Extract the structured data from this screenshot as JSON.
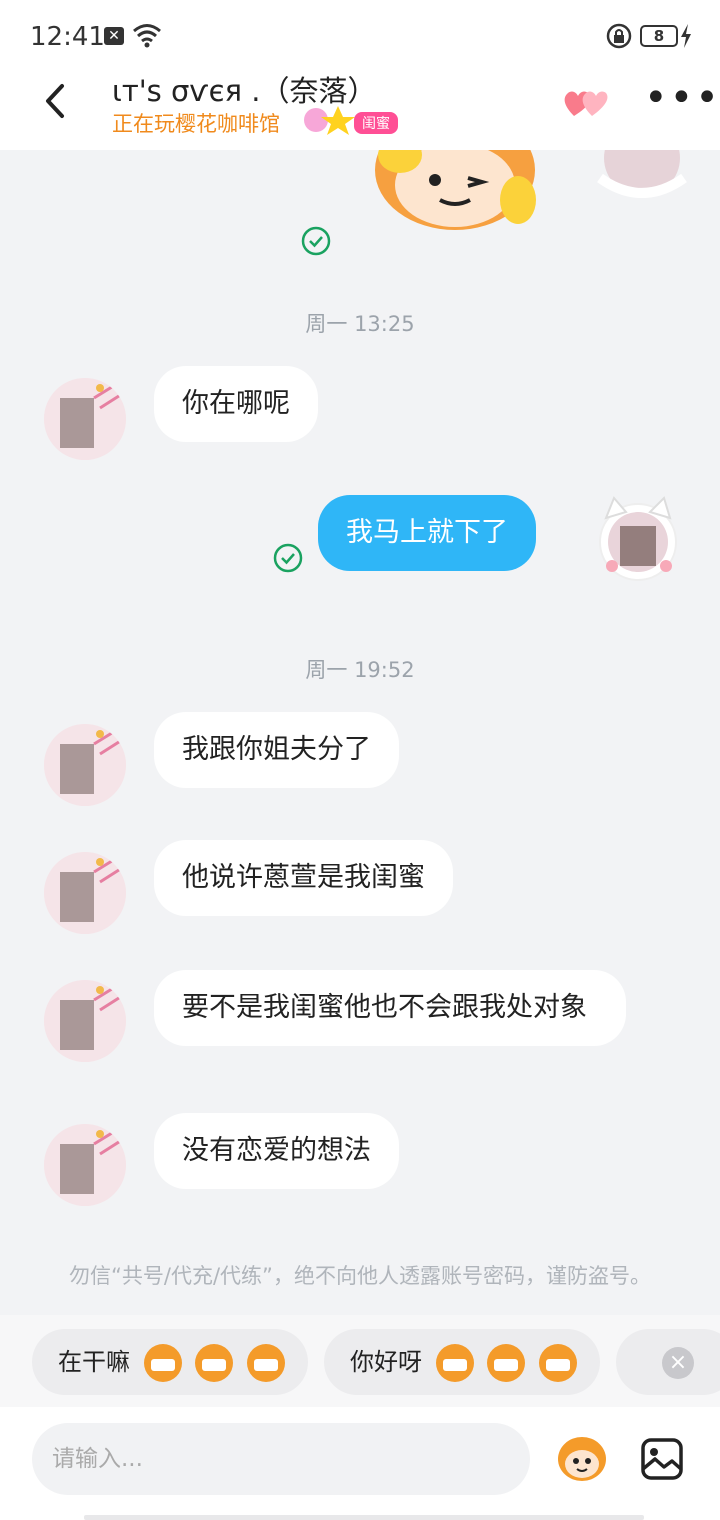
{
  "status_bar": {
    "time": "12:41",
    "notif_badge": "✕",
    "battery": "8"
  },
  "header": {
    "back_icon": "chevron-left-icon",
    "contact_name": "ιт'ѕ σѵєя .（奈落）",
    "playing_status": "正在玩樱花咖啡馆",
    "relationship_tag": "闺蜜",
    "accent_color": "#f08a1c"
  },
  "chat": {
    "messages": [
      {
        "type": "time",
        "text": "周一 13:25"
      },
      {
        "type": "received",
        "text": "你在哪呢"
      },
      {
        "type": "sent",
        "text": "我马上就下了"
      },
      {
        "type": "time",
        "text": "周一 19:52"
      },
      {
        "type": "received",
        "text": "我跟你姐夫分了"
      },
      {
        "type": "received",
        "text": "他说许蒽萱是我闺蜜"
      },
      {
        "type": "received",
        "text": "要不是我闺蜜他也不会跟我处对象"
      },
      {
        "type": "received",
        "text": "没有恋爱的想法"
      }
    ],
    "notice": "勿信“共号/代充/代练”，绝不向他人透露账号密码，谨防盗号。",
    "sent_bubble_color": "#2fb6f7"
  },
  "quick_replies": [
    {
      "label": "在干嘛"
    },
    {
      "label": "你好呀"
    }
  ],
  "input": {
    "placeholder": "请输入..."
  }
}
